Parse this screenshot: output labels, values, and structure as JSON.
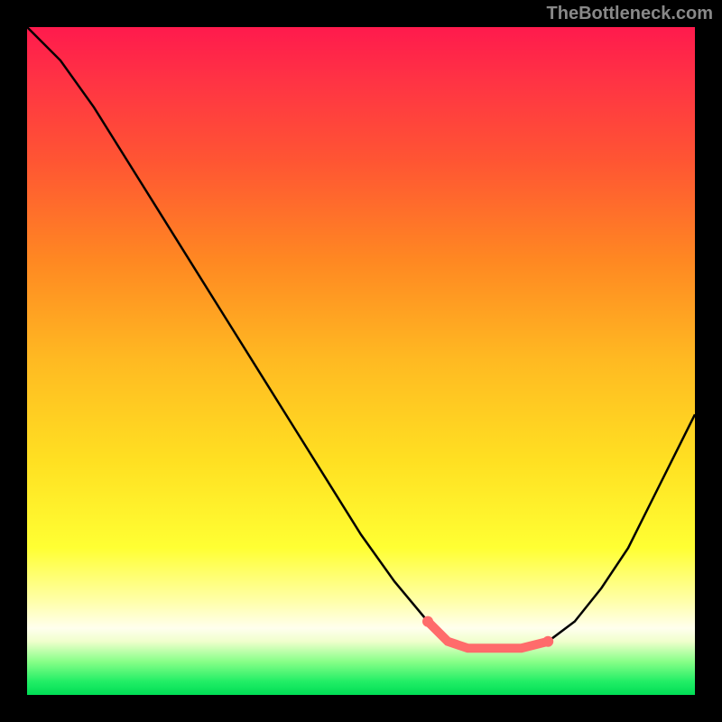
{
  "watermark": "TheBottleneck.com",
  "chart_data": {
    "type": "line",
    "title": "",
    "xlabel": "",
    "ylabel": "",
    "xlim": [
      0,
      100
    ],
    "ylim": [
      0,
      100
    ],
    "series": [
      {
        "name": "bottleneck-curve",
        "x": [
          0,
          5,
          10,
          15,
          20,
          25,
          30,
          35,
          40,
          45,
          50,
          55,
          60,
          63,
          66,
          70,
          74,
          78,
          82,
          86,
          90,
          94,
          98,
          100
        ],
        "values": [
          100,
          95,
          88,
          80,
          72,
          64,
          56,
          48,
          40,
          32,
          24,
          17,
          11,
          8,
          7,
          7,
          7,
          8,
          11,
          16,
          22,
          30,
          38,
          42
        ]
      }
    ],
    "highlight": {
      "name": "optimal-range",
      "x": [
        60,
        63,
        66,
        70,
        74,
        78
      ],
      "values": [
        11,
        8,
        7,
        7,
        7,
        8
      ],
      "color": "#ff6b6b"
    },
    "gradient_stops": [
      {
        "pos": 0.0,
        "color": "#ff1a4d"
      },
      {
        "pos": 0.08,
        "color": "#ff3344"
      },
      {
        "pos": 0.2,
        "color": "#ff5533"
      },
      {
        "pos": 0.35,
        "color": "#ff8822"
      },
      {
        "pos": 0.5,
        "color": "#ffba22"
      },
      {
        "pos": 0.65,
        "color": "#ffe022"
      },
      {
        "pos": 0.78,
        "color": "#ffff33"
      },
      {
        "pos": 0.86,
        "color": "#ffffaa"
      },
      {
        "pos": 0.9,
        "color": "#ffffee"
      },
      {
        "pos": 0.92,
        "color": "#f0ffcc"
      },
      {
        "pos": 0.95,
        "color": "#88ff88"
      },
      {
        "pos": 0.98,
        "color": "#22ee66"
      },
      {
        "pos": 1.0,
        "color": "#00dd55"
      }
    ]
  }
}
